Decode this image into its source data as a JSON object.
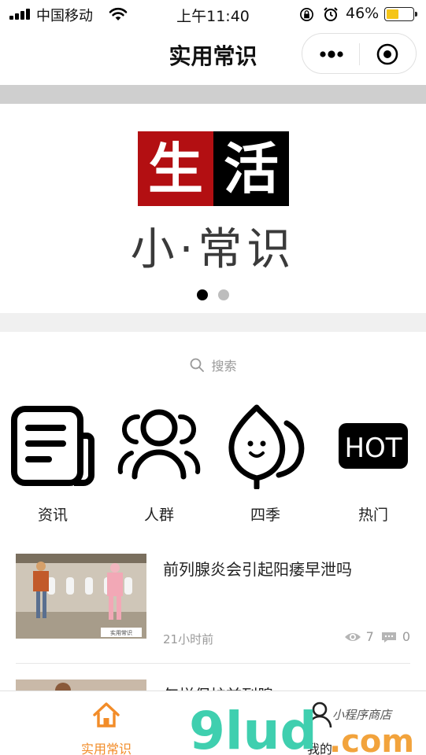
{
  "status_bar": {
    "carrier": "中国移动",
    "time": "上午11:40",
    "battery_percent": "46%",
    "battery_level": 0.46
  },
  "nav": {
    "title": "实用常识"
  },
  "banner": {
    "logo_left": "生",
    "logo_right": "活",
    "logo_sub": "小·常识",
    "slide_count": 2,
    "active_slide": 1
  },
  "search": {
    "placeholder": "搜索"
  },
  "categories": [
    {
      "label": "资讯",
      "icon": "news-icon"
    },
    {
      "label": "人群",
      "icon": "people-icon"
    },
    {
      "label": "四季",
      "icon": "leaf-icon"
    },
    {
      "label": "热门",
      "icon": "hot-icon",
      "icon_text": "HOT"
    }
  ],
  "articles": [
    {
      "title": "前列腺炎会引起阳痿早泄吗",
      "time": "21小时前",
      "views": "7",
      "comments": "0",
      "thumb_caption": "实用常识"
    },
    {
      "title": "怎样保护前列腺"
    }
  ],
  "tabs": [
    {
      "label": "实用常识",
      "icon": "home-icon",
      "active": true
    },
    {
      "label": "我的",
      "icon": "user-icon",
      "active": false
    }
  ],
  "watermark": {
    "logo": "9lud",
    "suffix": ".com",
    "tagline": "小程序商店"
  },
  "colors": {
    "accent": "#f28c28",
    "logo_red": "#b30f12",
    "watermark_green": "#3fcfaf",
    "watermark_orange": "#f2a33c"
  }
}
